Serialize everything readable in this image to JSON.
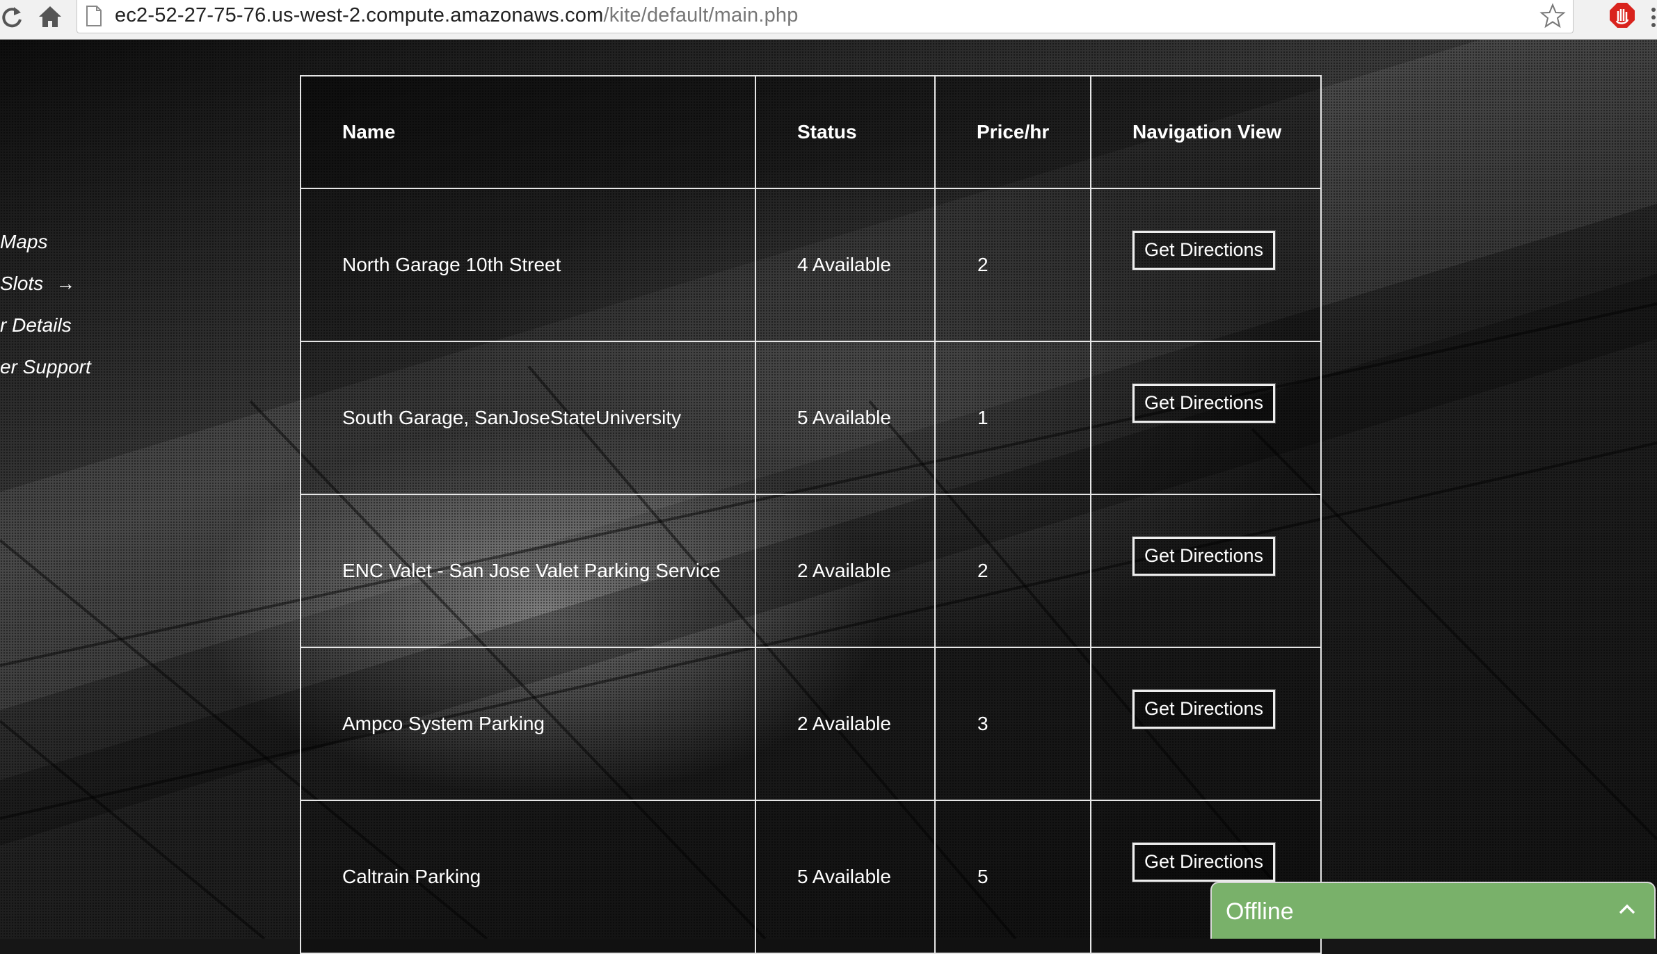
{
  "browser": {
    "url_host": "ec2-52-27-75-76.us-west-2.compute.amazonaws.com",
    "url_path": "/kite/default/main.php"
  },
  "sidenav": {
    "items": [
      {
        "label": "Maps"
      },
      {
        "label": "Slots",
        "arrow": "→"
      },
      {
        "label": "r Details"
      },
      {
        "label": "er Support"
      }
    ]
  },
  "table": {
    "headers": [
      "Name",
      "Status",
      "Price/hr",
      "Navigation View"
    ],
    "button_label": "Get Directions",
    "rows": [
      {
        "name": "North Garage 10th Street",
        "status": "4 Available",
        "price": "2"
      },
      {
        "name": "South Garage, SanJoseStateUniversity",
        "status": "5 Available",
        "price": "1"
      },
      {
        "name": "ENC Valet - San Jose Valet Parking Service",
        "status": "2 Available",
        "price": "2"
      },
      {
        "name": "Ampco System Parking",
        "status": "2 Available",
        "price": "3"
      },
      {
        "name": "Caltrain Parking",
        "status": "5 Available",
        "price": "5"
      }
    ]
  },
  "chat_widget": {
    "label": "Offline",
    "color": "#79b16a"
  },
  "icons": {
    "reload": "reload-icon",
    "home": "home-icon",
    "page": "page-icon",
    "star": "star-icon",
    "extension": "adblock-icon",
    "menu": "menu-icon",
    "chevron": "chevron-up-icon"
  }
}
